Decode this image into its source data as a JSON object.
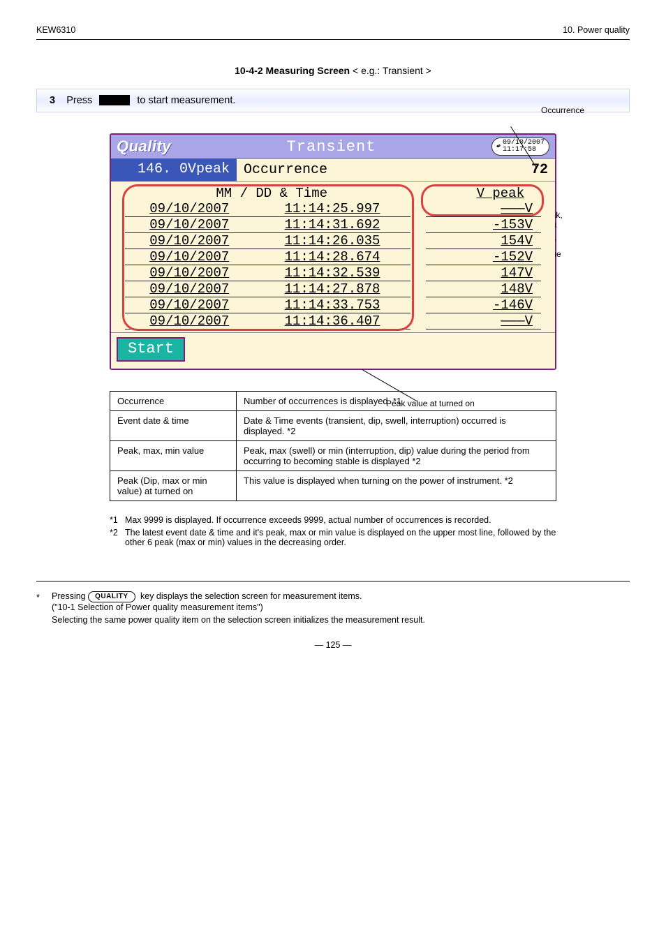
{
  "running_head": {
    "left": "KEW6310",
    "right": "10. Power quality"
  },
  "tab_caption_prefix": "10-4-2 Measuring Screen",
  "tab_caption_suffix": "  < e.g.: Transient >",
  "section_bar": {
    "step_no": "3",
    "label": "Press",
    "after": "to start measurement."
  },
  "screen": {
    "brand": "Quality",
    "title": "Transient",
    "clock_date": "09/10/2007",
    "clock_time": "11:17:58",
    "peak": "146. 0Vpeak",
    "occ_label": "Occurrence",
    "occ_count": "72",
    "head_date": "MM / DD & Time",
    "head_v": "V peak",
    "rows": [
      {
        "d": "09/10/2007",
        "t": "11:14:25.997",
        "v": "———V"
      },
      {
        "d": "09/10/2007",
        "t": "11:14:31.692",
        "v": "-153V"
      },
      {
        "d": "09/10/2007",
        "t": "11:14:26.035",
        "v": "154V"
      },
      {
        "d": "09/10/2007",
        "t": "11:14:28.674",
        "v": "-152V"
      },
      {
        "d": "09/10/2007",
        "t": "11:14:32.539",
        "v": "147V"
      },
      {
        "d": "09/10/2007",
        "t": "11:14:27.878",
        "v": "148V"
      },
      {
        "d": "09/10/2007",
        "t": "11:14:33.753",
        "v": "-146V"
      },
      {
        "d": "09/10/2007",
        "t": "11:14:36.407",
        "v": "———V"
      }
    ],
    "start": "Start"
  },
  "callouts": {
    "a": "Occurrence",
    "b": "Peak, max or min value",
    "c": "Event date & time",
    "d": "Peak value at turned on"
  },
  "defs": [
    {
      "k": "Occurrence",
      "v": "Number of occurrences is displayed.  *1"
    },
    {
      "k": "Event date & time",
      "v": "Date & Time events (transient, dip, swell, interruption) occurred is displayed.  *2"
    },
    {
      "k": "Peak, max, min value",
      "v": "Peak, max (swell) or min (interruption, dip) value during the period from occurring to becoming stable is displayed *2"
    },
    {
      "k": "Peak (Dip, max or min value) at turned on",
      "v": "This value is displayed when turning on the power of instrument. *2"
    }
  ],
  "notes": [
    {
      "k": "*1",
      "v": "Max 9999 is displayed. If occurrence exceeds 9999, actual number of occurrences is recorded."
    },
    {
      "k": "*2",
      "v": "The latest event date & time and it's peak, max or min value is displayed on the upper most line, followed by the other 6 peak (max or min) values in the decreasing order."
    }
  ],
  "foot": {
    "pre": "*     Pressing",
    "btn": "QUALITY",
    "mid1": "key displays the selection screen for measurement items.",
    "mid2": "(\"10-1 Selection of Power quality measurement items\")",
    "line3": "Selecting the same power quality item on the selection screen initializes the measurement result."
  },
  "page_no": "― 125 ―"
}
